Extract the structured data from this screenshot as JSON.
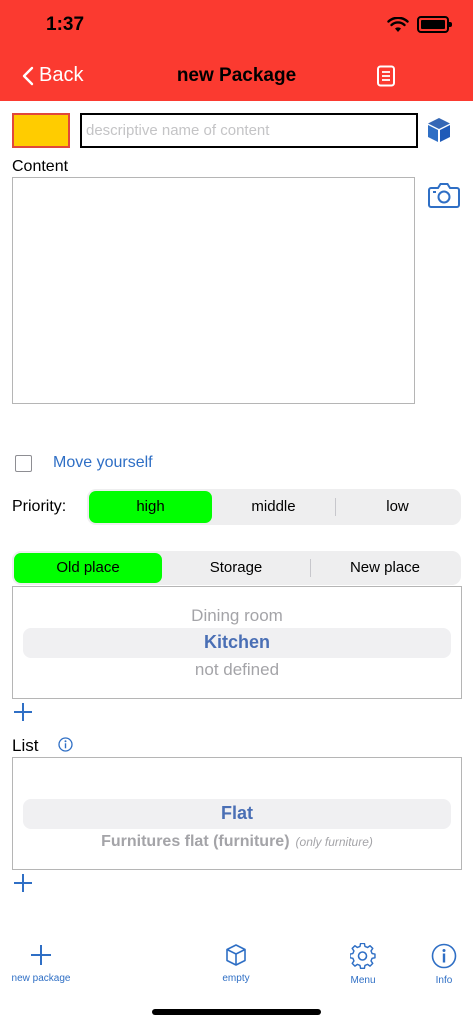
{
  "status_bar": {
    "time": "1:37"
  },
  "nav": {
    "back_label": "Back",
    "title": "new Package"
  },
  "form": {
    "name_placeholder": "descriptive name of content",
    "content_label": "Content",
    "move_yourself_label": "Move yourself",
    "move_yourself_checked": false,
    "priority_label": "Priority:",
    "priority_options": [
      "high",
      "middle",
      "low"
    ],
    "priority_selected": "high",
    "place_options": [
      "Old place",
      "Storage",
      "New place"
    ],
    "place_selected": "Old place",
    "place_picker": {
      "above": "Dining room",
      "selected": "Kitchen",
      "below": "not defined"
    },
    "list_label": "List",
    "list_picker": {
      "selected": "Flat",
      "below": "Furnitures flat (furniture)",
      "below_note": "(only furniture)"
    }
  },
  "tabbar": {
    "items": [
      "new package",
      "empty",
      "Menu",
      "Info"
    ]
  },
  "colors": {
    "header": "#fb3a30",
    "accent": "#2f6fc5",
    "selected_segment": "#00ff00",
    "swatch": "#ffcc00"
  },
  "icons": [
    "back-chevron-icon",
    "document-icon",
    "cube-icon",
    "camera-icon",
    "plus-icon",
    "info-icon",
    "gear-icon"
  ]
}
